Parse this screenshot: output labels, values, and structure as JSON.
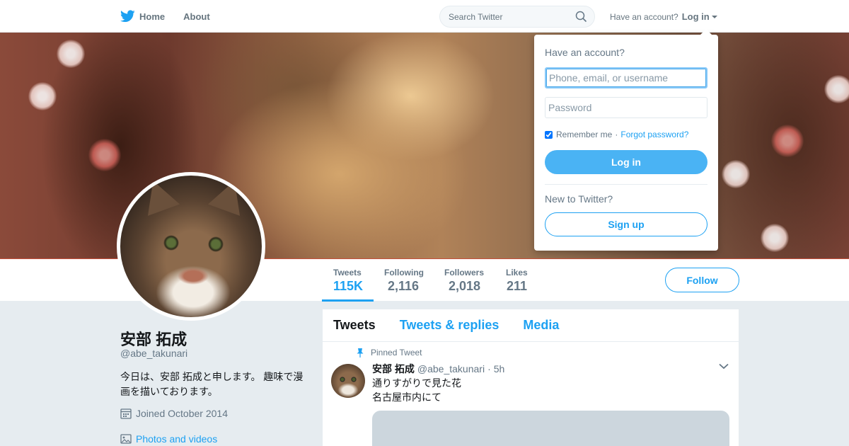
{
  "topnav": {
    "home_label": "Home",
    "about_label": "About",
    "search_placeholder": "Search Twitter",
    "have_account": "Have an account?",
    "login_label": "Log in",
    "icons": {
      "home": "twitter-bird-icon",
      "search": "search-icon",
      "login": "caret-down-icon"
    }
  },
  "profile_nav": {
    "stats": [
      {
        "label": "Tweets",
        "value": "115K",
        "active": true
      },
      {
        "label": "Following",
        "value": "2,116"
      },
      {
        "label": "Followers",
        "value": "2,018"
      },
      {
        "label": "Likes",
        "value": "211"
      }
    ],
    "follow_label": "Follow"
  },
  "profile": {
    "name": "安部 拓成",
    "handle": "@abe_takunari",
    "bio": "今日は、安部 拓成と申します。 趣味で漫画を描いております。",
    "joined": "Joined October 2014",
    "photos_link": "Photos and videos"
  },
  "timeline": {
    "tabs": [
      "Tweets",
      "Tweets & replies",
      "Media"
    ],
    "active_tab": "Tweets",
    "tweet": {
      "pinned_label": "Pinned Tweet",
      "name": "安部 拓成",
      "handle": "@abe_takunari",
      "separator": "·",
      "time": "5h",
      "lines": [
        "通りすがりで見た花",
        "名古屋市内にて"
      ]
    }
  },
  "login_dropdown": {
    "title": "Have an account?",
    "username_placeholder": "Phone, email, or username",
    "password_placeholder": "Password",
    "remember_label": "Remember me",
    "separator": "·",
    "forgot_label": "Forgot password?",
    "login_button": "Log in",
    "new_label": "New to Twitter?",
    "signup_button": "Sign up"
  },
  "colors": {
    "accent": "#1da1f2",
    "muted": "#657786",
    "background": "#e6ecf0"
  }
}
